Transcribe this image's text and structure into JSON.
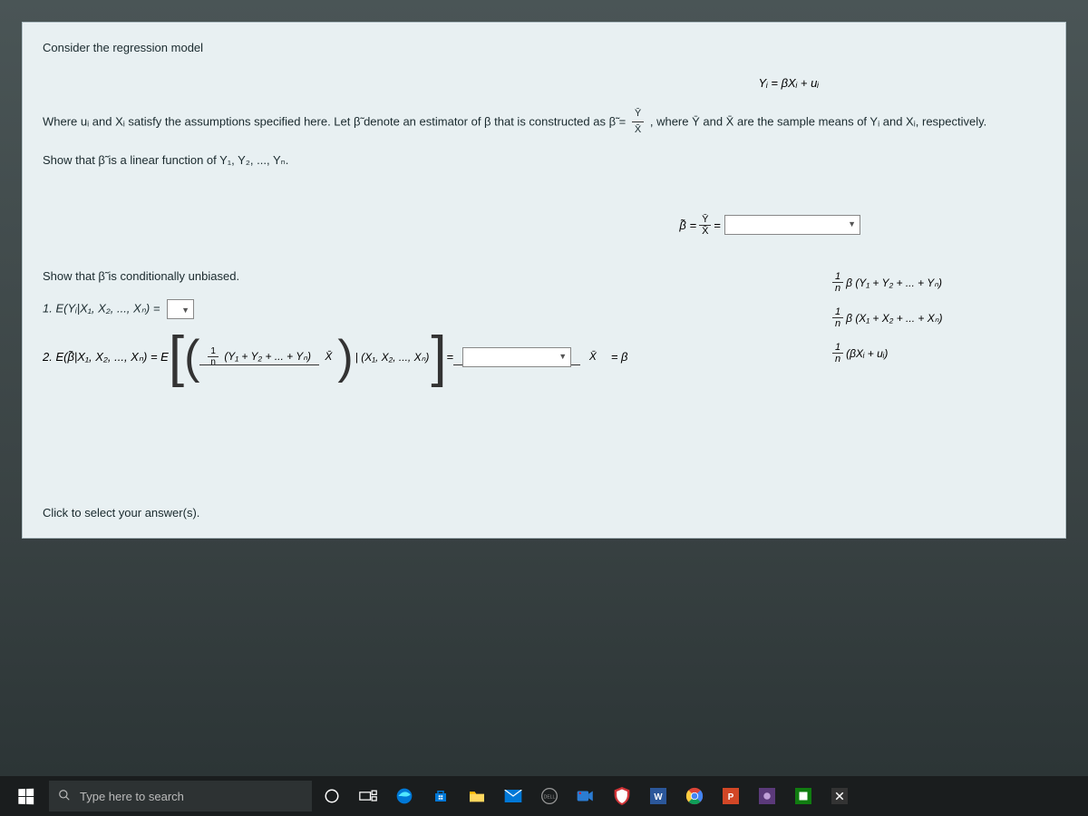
{
  "problem": {
    "intro": "Consider the regression model",
    "model_equation": "Yᵢ = βXᵢ + uᵢ",
    "where_clause_pre": "Where uᵢ and Xᵢ satisfy the assumptions specified here. Let β̃ denote an estimator of β that is constructed as β̃ = ",
    "frac_top_1": "Ȳ",
    "frac_bot_1": "X̄",
    "where_clause_post": ", where Ȳ and X̄ are the sample means of Yᵢ and Xᵢ, respectively.",
    "show_linear": "Show that β̃ is a linear function of Y₁, Y₂, ..., Yₙ.",
    "beta_eq_lhs": "β̃ = ",
    "frac_top_2": "Ȳ",
    "frac_bot_2": "X̄",
    "equals": " = ",
    "show_unbiased": "Show that β̃ is conditionally unbiased.",
    "q1_lhs": "1. E(Yᵢ|X₁, X₂, ..., Xₙ) = ",
    "q2_lhs": "2. E(β̃|X₁, X₂, ..., Xₙ) = E",
    "q2_num_frac_n": "1",
    "q2_num_frac_d": "n",
    "q2_num_rest": " (Y₁ + Y₂ + ... + Yₙ)",
    "q2_den": "X̄",
    "q2_pipe": "| (X₁, X₂, ..., Xₙ)",
    "q2_mid_eq": " = ",
    "q2_result": " = β",
    "click_hint": "Click to select your answer(s)."
  },
  "options": {
    "opt1_frac_n": "1",
    "opt1_frac_d": "n",
    "opt1_rest": "β (Y₁ + Y₂ + ... + Yₙ)",
    "opt2_frac_n": "1",
    "opt2_frac_d": "n",
    "opt2_rest": "β (X₁ + X₂ + ... + Xₙ)",
    "opt3_frac_n": "1",
    "opt3_frac_d": "n",
    "opt3_rest": " (βXᵢ + uᵢ)"
  },
  "taskbar": {
    "search_placeholder": "Type here to search"
  }
}
